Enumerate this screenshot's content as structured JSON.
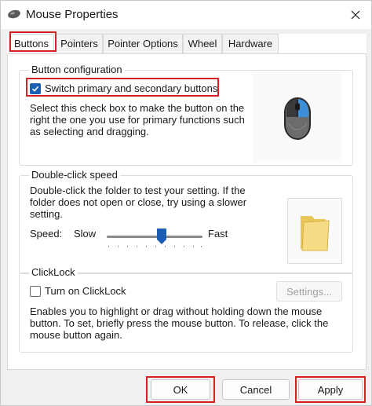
{
  "window": {
    "title": "Mouse Properties"
  },
  "tabs": [
    {
      "label": "Buttons",
      "active": true
    },
    {
      "label": "Pointers",
      "active": false
    },
    {
      "label": "Pointer Options",
      "active": false
    },
    {
      "label": "Wheel",
      "active": false
    },
    {
      "label": "Hardware",
      "active": false
    }
  ],
  "button_configuration": {
    "legend": "Button configuration",
    "switch_checkbox": {
      "label": "Switch primary and secondary buttons",
      "checked": true
    },
    "description": [
      "Select this check box to make the button on the",
      "right the one you use for primary functions such",
      "as selecting and dragging."
    ]
  },
  "double_click": {
    "legend": "Double-click speed",
    "description": [
      "Double-click the folder to test your setting. If the",
      "folder does not open or close, try using a slower",
      "setting."
    ],
    "speed_label": "Speed:",
    "slow_label": "Slow",
    "fast_label": "Fast",
    "speed_value_fraction": 0.55
  },
  "clicklock": {
    "legend": "ClickLock",
    "checkbox": {
      "label": "Turn on ClickLock",
      "checked": false
    },
    "settings_button": "Settings...",
    "description": [
      "Enables you to highlight or drag without holding down the mouse",
      "button. To set, briefly press the mouse button. To release, click the",
      "mouse button again."
    ]
  },
  "footer": {
    "ok": "OK",
    "cancel": "Cancel",
    "apply": "Apply"
  },
  "colors": {
    "highlight_red": "#d32020",
    "accent_blue": "#1b5fb5"
  },
  "icons": [
    "mouse-app-icon",
    "close-icon",
    "checkmark-icon",
    "mouse-device-icon",
    "folder-icon",
    "slider-thumb-icon"
  ]
}
